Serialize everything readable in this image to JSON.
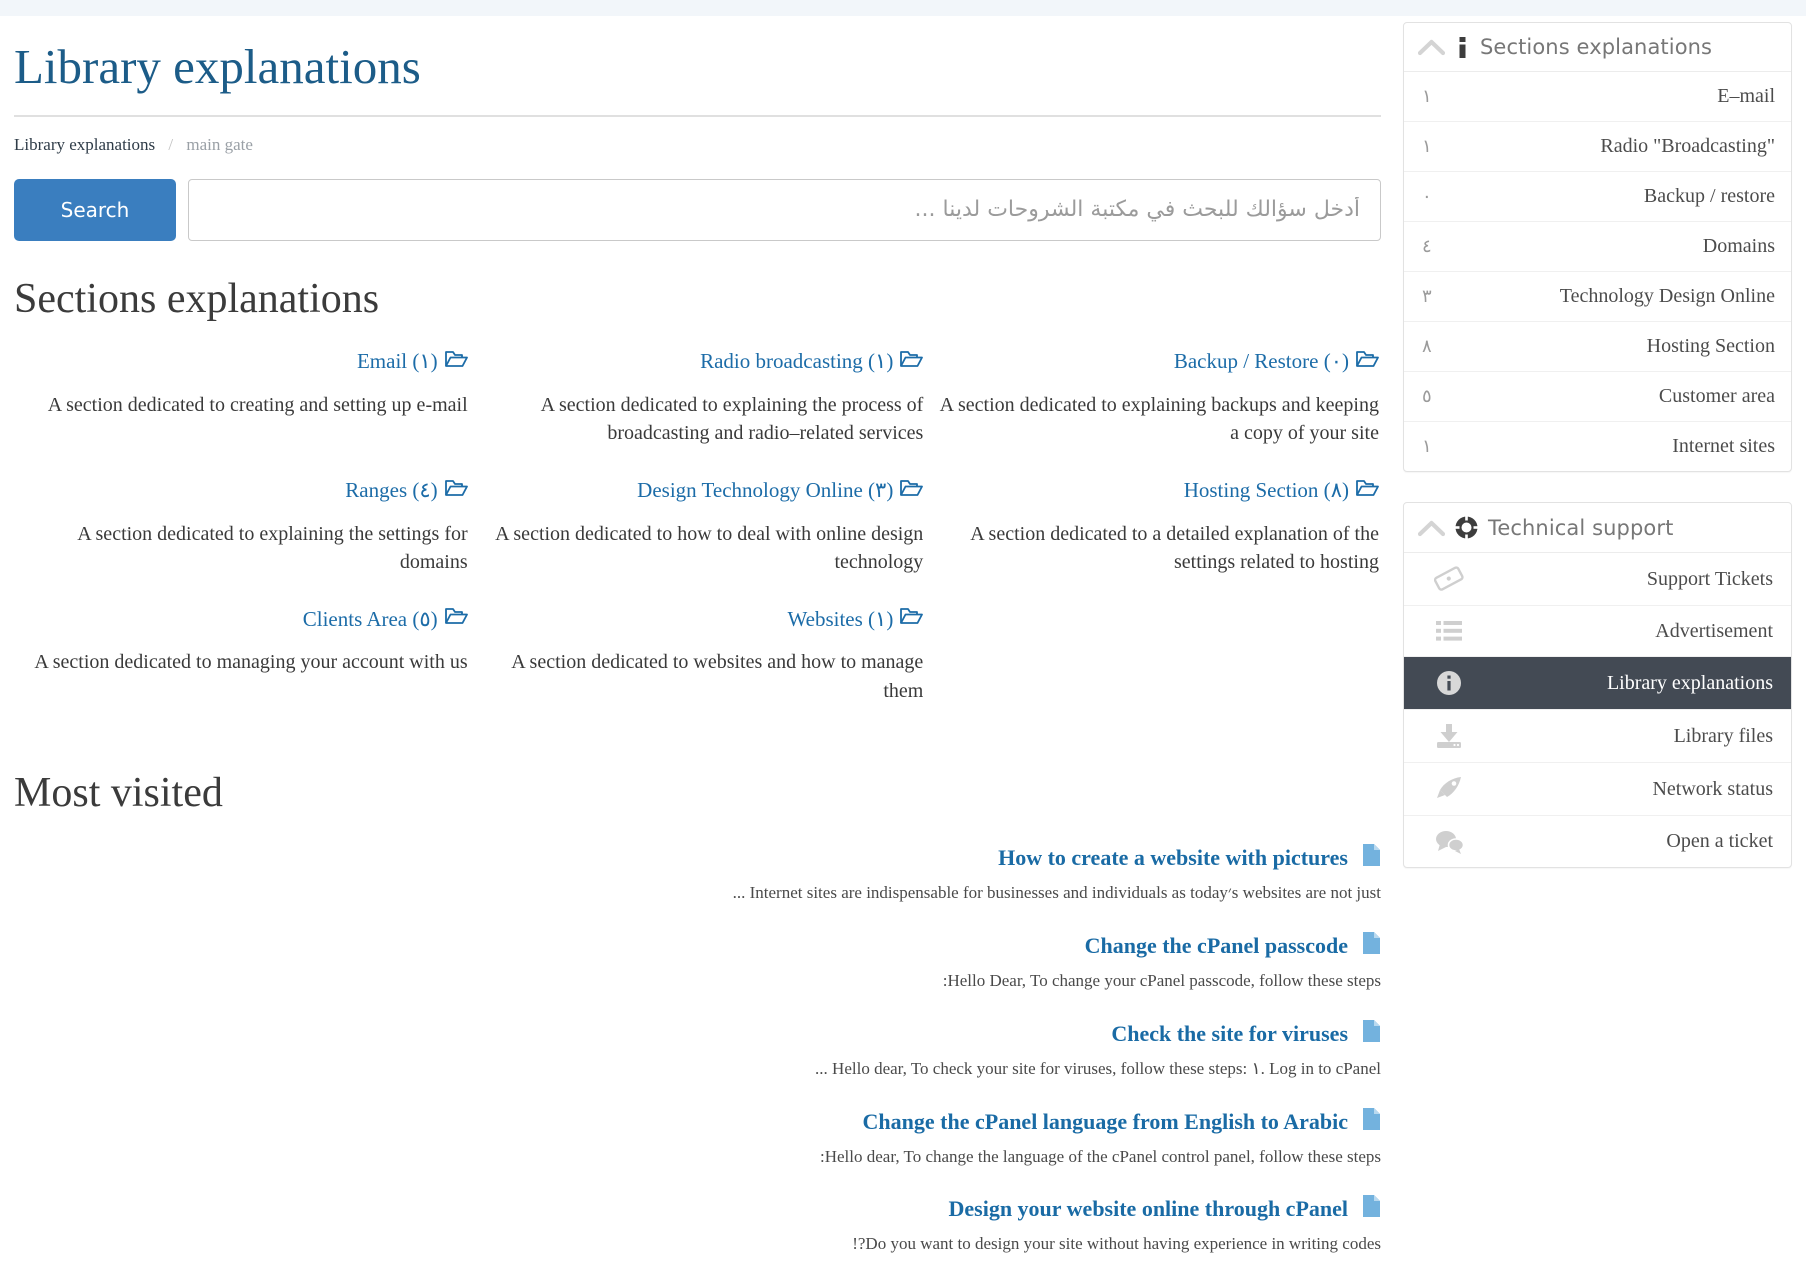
{
  "header": {
    "page_title": "Library explanations",
    "breadcrumb_active": "Library explanations",
    "breadcrumb_separator": "/",
    "breadcrumb_parent": "main gate"
  },
  "search": {
    "button_label": "Search",
    "placeholder": "أدخل سؤالك للبحث في مكتبة الشروحات لدينا ...",
    "value": ""
  },
  "sections": {
    "heading": "Sections explanations",
    "cards": [
      {
        "title": "Email",
        "count": "١",
        "desc": "A section dedicated to creating and setting up e-mail",
        "icon": "folder-open-icon"
      },
      {
        "title": "Radio broadcasting",
        "count": "١",
        "desc": "A section dedicated to explaining the process of broadcasting and radio–related services",
        "icon": "folder-open-icon"
      },
      {
        "title": "Backup / Restore",
        "count": "٠",
        "desc": "A section dedicated to explaining backups and keeping a copy of your site",
        "icon": "folder-open-icon"
      },
      {
        "title": "Ranges",
        "count": "٤",
        "desc": "A section dedicated to explaining the settings for domains",
        "icon": "folder-open-icon"
      },
      {
        "title": "Design Technology Online",
        "count": "٣",
        "desc": "A section dedicated to how to deal with online design technology",
        "icon": "folder-open-icon"
      },
      {
        "title": "Hosting Section",
        "count": "٨",
        "desc": "A section dedicated to a detailed explanation of the settings related to hosting",
        "icon": "folder-open-icon"
      },
      {
        "title": "Clients Area",
        "count": "٥",
        "desc": "A section dedicated to managing your account with us",
        "icon": "folder-open-icon"
      },
      {
        "title": "Websites",
        "count": "١",
        "desc": "A section dedicated to websites and how to manage them",
        "icon": "folder-open-icon"
      }
    ]
  },
  "most_visited": {
    "heading": "Most visited",
    "articles": [
      {
        "title": "How to create a website with pictures",
        "excerpt": "... Internet sites are indispensable for businesses and individuals as today׳s websites are not just",
        "icon": "document-icon"
      },
      {
        "title": "Change the cPanel passcode",
        "excerpt": ":Hello Dear, To change your cPanel passcode, follow these steps",
        "icon": "document-icon"
      },
      {
        "title": "Check the site for viruses",
        "excerpt": "... Hello dear, To check your site for viruses, follow these steps: ١. Log in to cPanel",
        "icon": "document-icon"
      },
      {
        "title": "Change the cPanel language from English to Arabic",
        "excerpt": ":Hello dear, To change the language of the cPanel control panel, follow these steps",
        "icon": "document-icon"
      },
      {
        "title": "Design your website online through cPanel",
        "excerpt": "!?Do you want to design your site without having experience in writing codes",
        "icon": "document-icon"
      }
    ]
  },
  "sidebar": {
    "sections_panel": {
      "title": "Sections explanations",
      "head_icon": "info-bold-icon",
      "collapse_icon": "chevron-up-icon",
      "rows": [
        {
          "label": "E–mail",
          "count": "١"
        },
        {
          "label": "\"Radio \"Broadcasting",
          "count": "١"
        },
        {
          "label": "Backup / restore",
          "count": "٠"
        },
        {
          "label": "Domains",
          "count": "٤"
        },
        {
          "label": "Technology Design Online",
          "count": "٣"
        },
        {
          "label": "Hosting Section",
          "count": "٨"
        },
        {
          "label": "Customer area",
          "count": "٥"
        },
        {
          "label": "Internet sites",
          "count": "١"
        }
      ]
    },
    "support_panel": {
      "title": "Technical support",
      "head_icon": "lifebuoy-icon",
      "collapse_icon": "chevron-up-icon",
      "rows": [
        {
          "label": "Support Tickets",
          "icon": "ticket-icon",
          "active": false
        },
        {
          "label": "Advertisement",
          "icon": "list-icon",
          "active": false
        },
        {
          "label": "Library explanations",
          "icon": "info-circle-icon",
          "active": true
        },
        {
          "label": "Library files",
          "icon": "download-inbox-icon",
          "active": false
        },
        {
          "label": "Network status",
          "icon": "rocket-icon",
          "active": false
        },
        {
          "label": "Open a ticket",
          "icon": "comments-icon",
          "active": false
        }
      ]
    }
  },
  "colors": {
    "title_blue": "#1c5c88",
    "link_blue": "#1c6ca8",
    "button_blue": "#3a7ebf",
    "active_row": "#434a54",
    "doc_icon_blue": "#73b2de",
    "topstrip": "#f2f6fa"
  }
}
